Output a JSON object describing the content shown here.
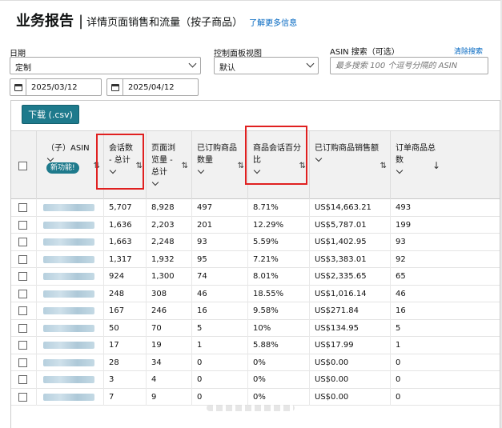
{
  "header": {
    "title": "业务报告",
    "separator": "|",
    "subtitle": "详情页面销售和流量（按子商品）",
    "learn_more": "了解更多信息"
  },
  "filters": {
    "date_label": "日期",
    "date_value": "定制",
    "view_label": "控制面板视图",
    "view_value": "默认",
    "asin_label": "ASIN 搜索（可选）",
    "clear_label": "清除搜索",
    "asin_placeholder": "最多搜索 100 个逗号分隔的 ASIN",
    "start_date": "2025/03/12",
    "end_date": "2025/04/12"
  },
  "toolbar": {
    "download_label": "下载 (.csv)"
  },
  "table": {
    "columns": {
      "asin": "（子）ASIN",
      "new_badge": "新功能!",
      "sessions": "会话数 - 总计",
      "pageviews": "页面浏览量 - 总计",
      "units": "已订购商品数量",
      "session_pct": "商品会话百分比",
      "sales": "已订购商品销售额",
      "orders": "订单商品总数"
    },
    "rows": [
      {
        "sessions": "5,707",
        "pageviews": "8,928",
        "units": "497",
        "pct": "8.71%",
        "sales": "US$14,663.21",
        "orders": "493"
      },
      {
        "sessions": "1,636",
        "pageviews": "2,203",
        "units": "201",
        "pct": "12.29%",
        "sales": "US$5,787.01",
        "orders": "199"
      },
      {
        "sessions": "1,663",
        "pageviews": "2,248",
        "units": "93",
        "pct": "5.59%",
        "sales": "US$1,402.95",
        "orders": "93"
      },
      {
        "sessions": "1,317",
        "pageviews": "1,932",
        "units": "95",
        "pct": "7.21%",
        "sales": "US$3,383.01",
        "orders": "92"
      },
      {
        "sessions": "924",
        "pageviews": "1,300",
        "units": "74",
        "pct": "8.01%",
        "sales": "US$2,335.65",
        "orders": "65"
      },
      {
        "sessions": "248",
        "pageviews": "308",
        "units": "46",
        "pct": "18.55%",
        "sales": "US$1,016.14",
        "orders": "46"
      },
      {
        "sessions": "167",
        "pageviews": "246",
        "units": "16",
        "pct": "9.58%",
        "sales": "US$271.84",
        "orders": "16"
      },
      {
        "sessions": "50",
        "pageviews": "70",
        "units": "5",
        "pct": "10%",
        "sales": "US$134.95",
        "orders": "5"
      },
      {
        "sessions": "17",
        "pageviews": "19",
        "units": "1",
        "pct": "5.88%",
        "sales": "US$17.99",
        "orders": "1"
      },
      {
        "sessions": "28",
        "pageviews": "34",
        "units": "0",
        "pct": "0%",
        "sales": "US$0.00",
        "orders": "0"
      },
      {
        "sessions": "3",
        "pageviews": "4",
        "units": "0",
        "pct": "0%",
        "sales": "US$0.00",
        "orders": "0"
      },
      {
        "sessions": "7",
        "pageviews": "9",
        "units": "0",
        "pct": "0%",
        "sales": "US$0.00",
        "orders": "0"
      }
    ]
  },
  "colors": {
    "accent": "#1e7a8c",
    "link": "#0066c0",
    "highlight": "#e02020"
  }
}
